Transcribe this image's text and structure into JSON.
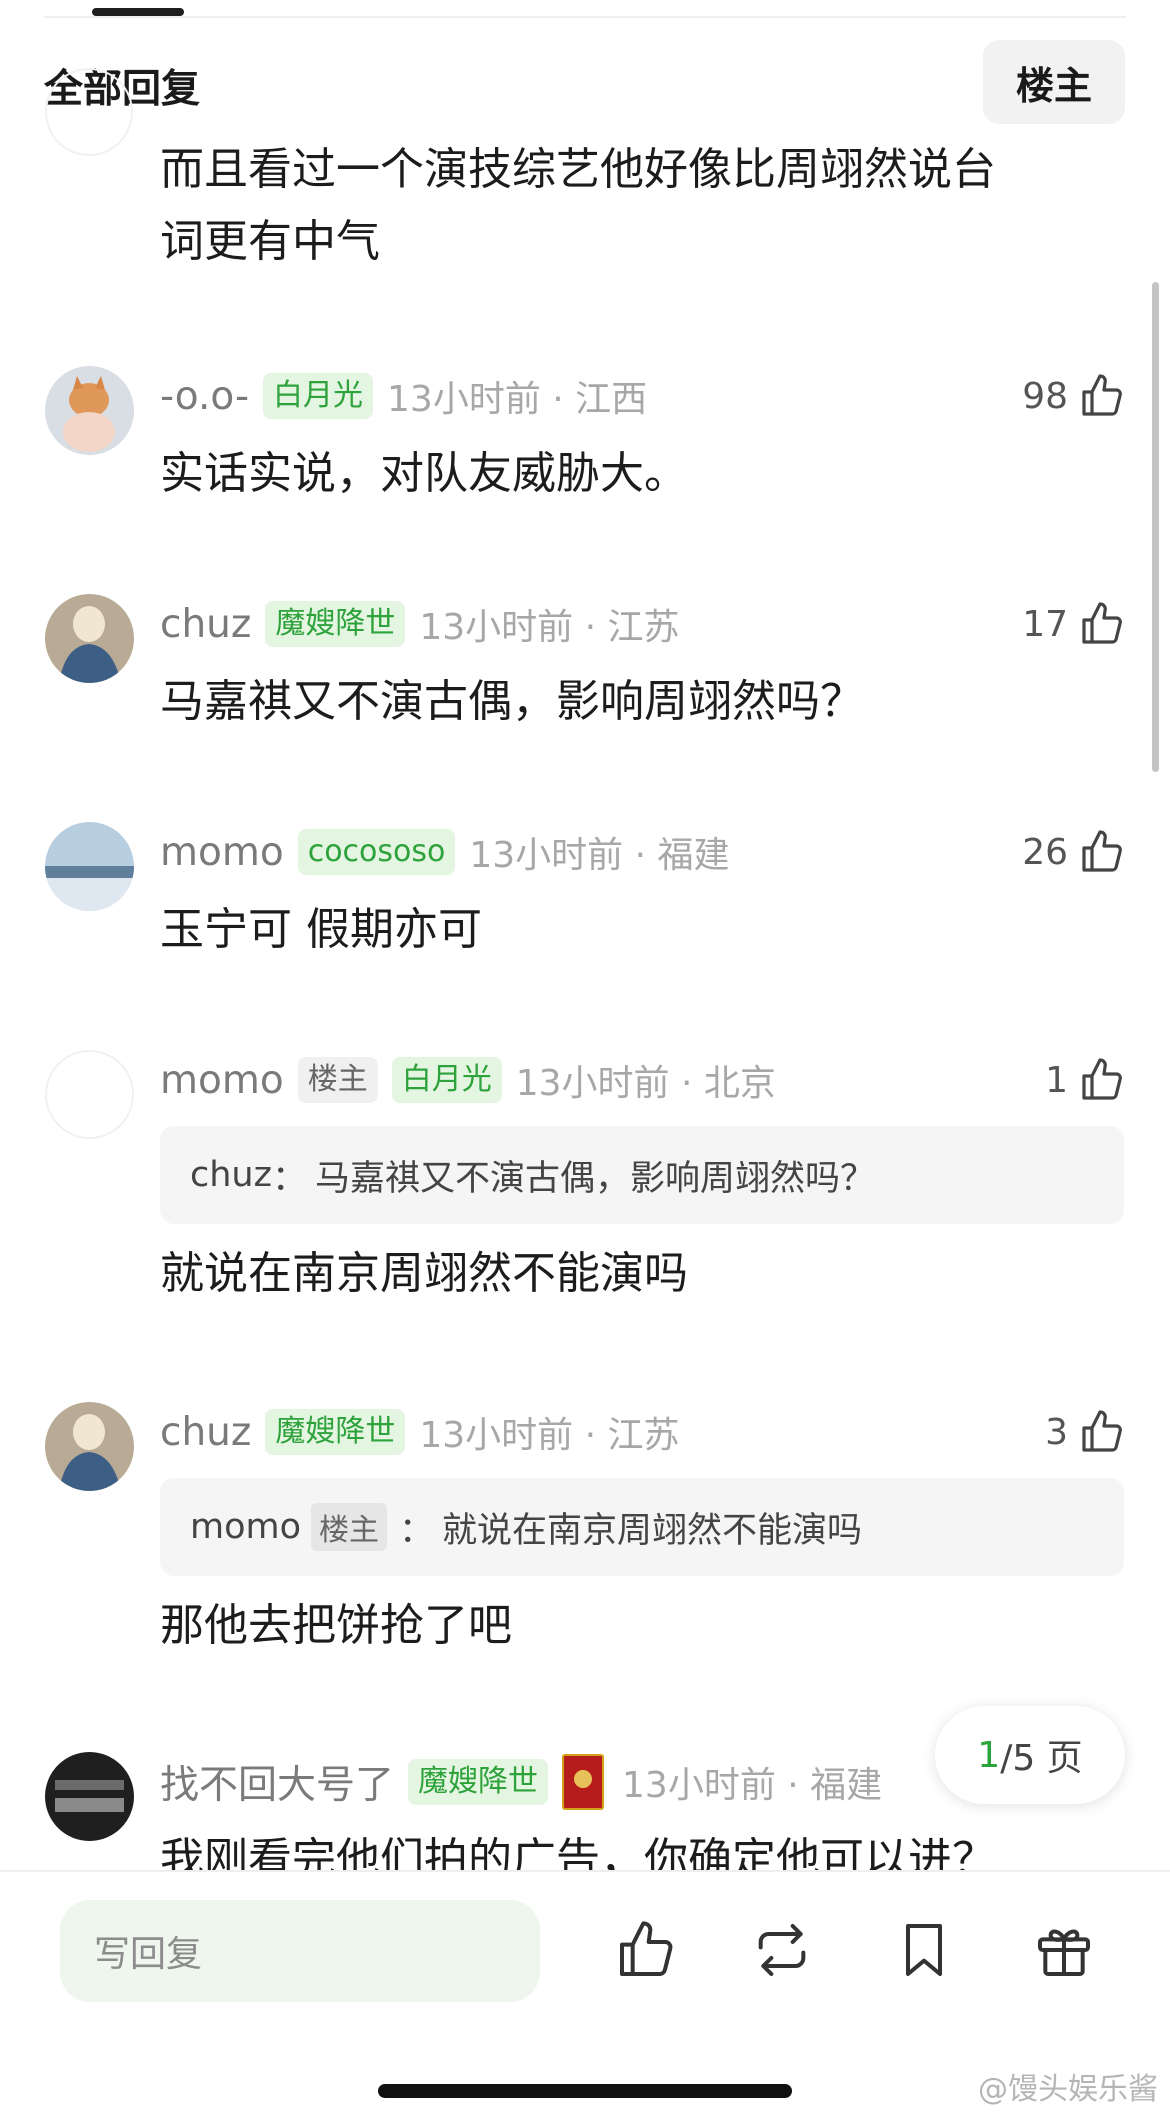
{
  "header": {
    "title": "全部回复",
    "op_filter_label": "楼主"
  },
  "continued_comment": {
    "text_line1": "而且看过一个演技综艺他好像比周翊然说台",
    "text_line2": "词更有中气"
  },
  "comments": [
    {
      "username": "-o.o-",
      "badges": [
        "白月光"
      ],
      "time_location": "13小时前 · 江西",
      "likes": "98",
      "text": "实话实说，对队友威胁大。"
    },
    {
      "username": "chuz",
      "badges": [
        "魔嫂降世"
      ],
      "time_location": "13小时前 · 江苏",
      "likes": "17",
      "text": "马嘉祺又不演古偶，影响周翊然吗？"
    },
    {
      "username": "momo",
      "badges": [
        "cocososo"
      ],
      "time_location": "13小时前 · 福建",
      "likes": "26",
      "text": "玉宁可 假期亦可"
    },
    {
      "username": "momo",
      "op_badge": "楼主",
      "badges": [
        "白月光"
      ],
      "time_location": "13小时前 · 北京",
      "likes": "1",
      "quote": {
        "author": "chuz",
        "separator": "：",
        "text": "马嘉祺又不演古偶，影响周翊然吗？"
      },
      "text": "就说在南京周翊然不能演吗"
    },
    {
      "username": "chuz",
      "badges": [
        "魔嫂降世"
      ],
      "time_location": "13小时前 · 江苏",
      "likes": "3",
      "quote": {
        "author": "momo",
        "author_badge": "楼主",
        "separator": "：",
        "text": "就说在南京周翊然不能演吗"
      },
      "text": "那他去把饼抢了吧"
    },
    {
      "username": "找不回大号了",
      "badges": [
        "魔嫂降世"
      ],
      "time_location": "13小时前 · 福建",
      "text": "我刚看完他们拍的广告，你确定他可以进？"
    }
  ],
  "pagination": {
    "current": "1",
    "total_text": "/5 页"
  },
  "bottom_bar": {
    "reply_placeholder": "写回复",
    "icons": [
      "like-icon",
      "repost-icon",
      "bookmark-icon",
      "gift-icon"
    ]
  },
  "watermark": "@馒头娱乐酱",
  "colors": {
    "accent_green": "#2ea23b",
    "badge_green_bg": "#e4f6e2",
    "meta_gray": "#a7a7a7"
  }
}
